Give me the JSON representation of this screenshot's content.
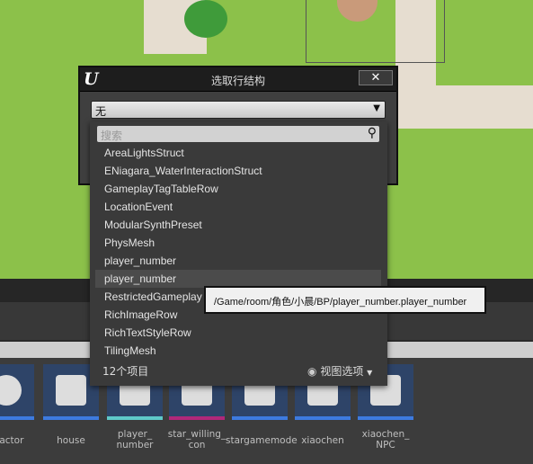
{
  "dialog": {
    "title": "选取行结构",
    "close_label": "✕",
    "logo": "U",
    "selected": "无"
  },
  "dropdown": {
    "search_placeholder": "搜索",
    "items": [
      "AreaLightsStruct",
      "ENiagara_WaterInteractionStruct",
      "GameplayTagTableRow",
      "LocationEvent",
      "ModularSynthPreset",
      "PhysMesh",
      "player_number",
      "player_number",
      "RestrictedGameplay",
      "RichImageRow",
      "RichTextStyleRow",
      "TilingMesh"
    ],
    "highlighted_index": 7,
    "count": "12个项目",
    "view_options": "视图选项"
  },
  "tooltip": "/Game/room/角色/小晨/BP/player_number.player_number",
  "assets": [
    {
      "label": "e_actor",
      "accent": "#3d7be0"
    },
    {
      "label": "house",
      "accent": "#3d7be0"
    },
    {
      "label": "player_\nnumber",
      "accent": "#5fc9c9"
    },
    {
      "label": "star_willing_\ncon",
      "accent": "#b0287a"
    },
    {
      "label": "stargamemode",
      "accent": "#3d7be0"
    },
    {
      "label": "xiaochen",
      "accent": "#3d7be0"
    },
    {
      "label": "xiaochen_\nNPC",
      "accent": "#3d7be0"
    }
  ]
}
